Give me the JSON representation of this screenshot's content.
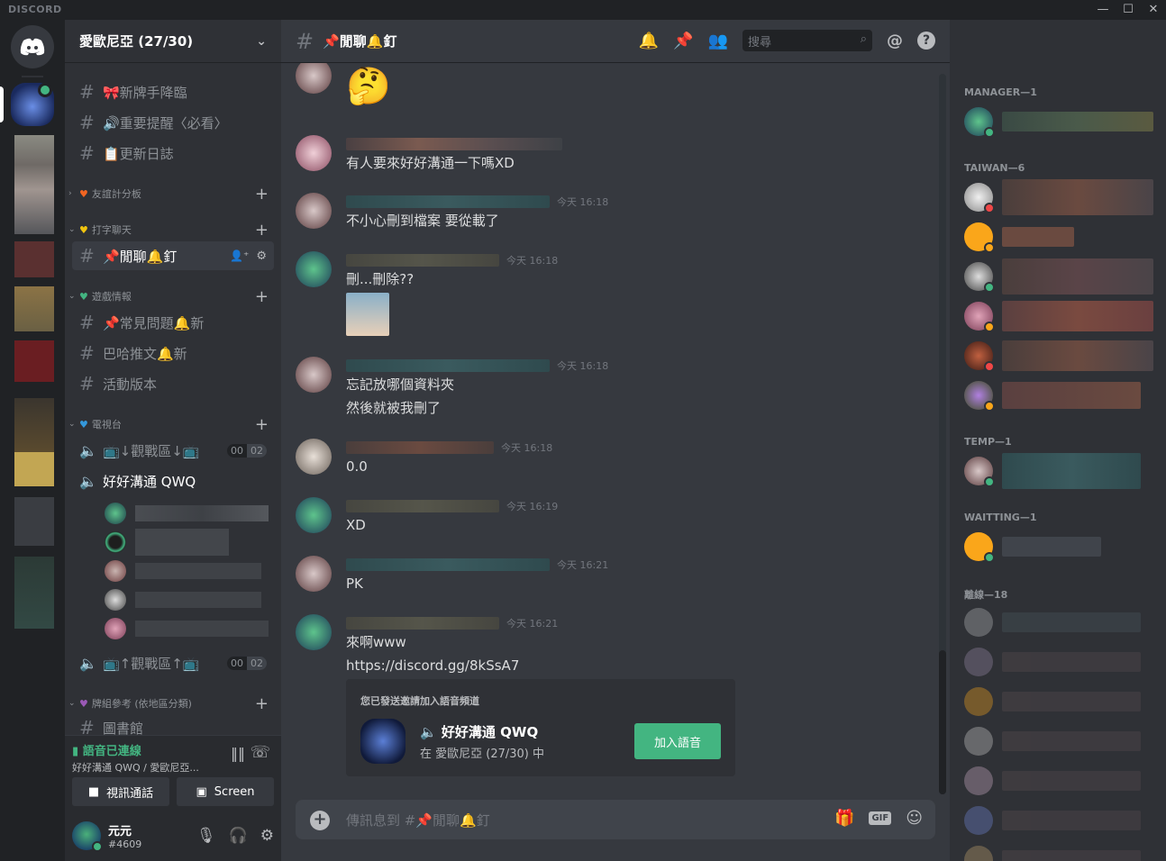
{
  "app": {
    "brand": "DISCORD",
    "win_min": "—",
    "win_max": "☐",
    "win_close": "✕"
  },
  "guild": {
    "name": "愛歐尼亞 (27/30)"
  },
  "channels": {
    "ch1": "🎀新牌手降臨",
    "ch2": "🔊重要提醒〈必看〉",
    "ch3": "📋更新日誌",
    "cat1": "友誼計分板",
    "cat2": "打字聊天",
    "active": "📌閒聊🔔釘",
    "cat3": "遊戲情報",
    "ch4": "📌常見問題🔔新",
    "ch5": "巴哈推文🔔新",
    "ch6": "活動版本",
    "cat4": "電視台",
    "voice1": "📺↓觀戰區↓📺",
    "voice_count_a": "00",
    "voice_count_b": "02",
    "voice2": "好好溝通 QWQ",
    "voice3": "📺↑觀戰區↑📺",
    "cat5": "牌組參考 (依地區分類)",
    "ch7": "圖書館"
  },
  "voice_panel": {
    "status": "語音已連線",
    "location": "好好溝通 QWQ / 愛歐尼亞...",
    "video_label": "視訊通話",
    "screen_label": "Screen"
  },
  "user": {
    "name": "元元",
    "discriminator": "#4609"
  },
  "chat": {
    "channel_title": "📌閒聊🔔釘",
    "search_placeholder": "搜尋",
    "messages": [
      {
        "text": "有人要來好好溝通一下嗎XD",
        "ts": ""
      },
      {
        "text": "不小心刪到檔案 要從載了",
        "ts": "今天 16:18"
      },
      {
        "text": "刪...刪除??",
        "ts": "今天 16:18"
      },
      {
        "text": "忘記放哪個資料夾",
        "text2": "然後就被我刪了",
        "ts": "今天 16:18"
      },
      {
        "text": "0.0",
        "ts": "今天 16:18"
      },
      {
        "text": "XD",
        "ts": "今天 16:19"
      },
      {
        "text": "PK",
        "ts": "今天 16:21"
      },
      {
        "text": "來啊www",
        "link": "https://discord.gg/8kSsA7",
        "ts": "今天 16:21"
      }
    ],
    "invite": {
      "label": "您已發送邀請加入語音頻道",
      "voice_name": "好好溝通 QWQ",
      "sub": "在 愛歐尼亞 (27/30) 中",
      "join": "加入語音"
    },
    "composer_placeholder": "傳訊息到 #📌閒聊🔔釘"
  },
  "members": {
    "roles": [
      "MANAGER—1",
      "TAIWAN—6",
      "TEMP—1",
      "WAITTING—1",
      "離線—18"
    ]
  }
}
